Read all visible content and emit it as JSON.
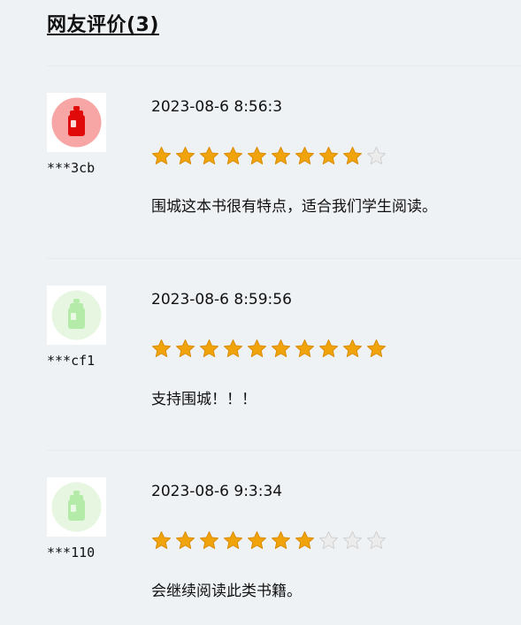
{
  "heading": "网友评价(3)",
  "colors": {
    "background": "#eff2f5",
    "star_filled": "#f0a30a",
    "star_empty": "#d8d8d8",
    "avatar_red": "#e10a0a",
    "avatar_green": "#a8e6a0"
  },
  "reviews": [
    {
      "username": "***3cb",
      "date": "2023-08-6 8:56:3",
      "rating": 9,
      "max_rating": 10,
      "comment": "围城这本书很有特点，适合我们学生阅读。",
      "avatar": "red-bottle-icon"
    },
    {
      "username": "***cf1",
      "date": "2023-08-6 8:59:56",
      "rating": 10,
      "max_rating": 10,
      "comment": "支持围城！！！",
      "avatar": "green-bottle-icon"
    },
    {
      "username": "***110",
      "date": "2023-08-6 9:3:34",
      "rating": 7,
      "max_rating": 10,
      "comment": "会继续阅读此类书籍。",
      "avatar": "green-bottle-icon"
    }
  ]
}
